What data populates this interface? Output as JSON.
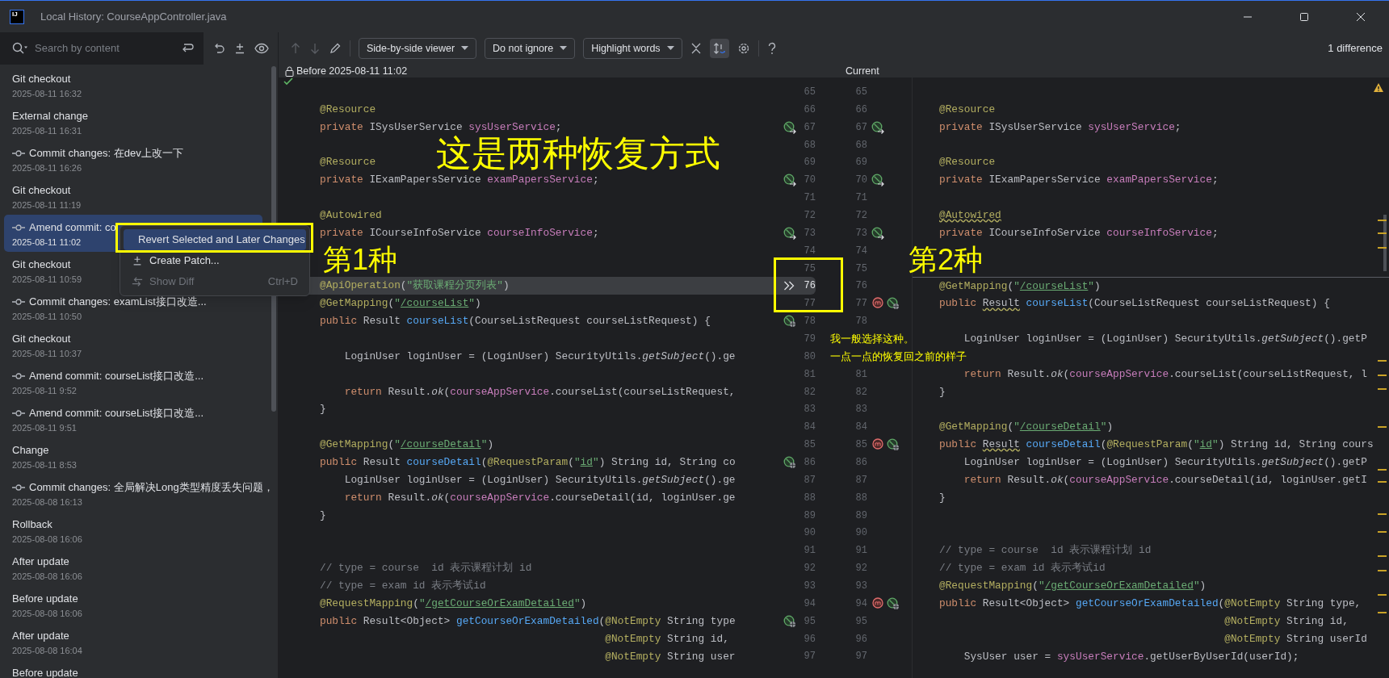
{
  "window": {
    "title": "Local History: CourseAppController.java",
    "app_icon": "IJ"
  },
  "history": {
    "search": {
      "placeholder": "Search by content"
    },
    "items": [
      {
        "kind": "event",
        "title": "Git checkout",
        "time": "2025-08-11 16:32",
        "selected": false
      },
      {
        "kind": "event",
        "title": "External change",
        "time": "2025-08-11 16:31",
        "selected": false
      },
      {
        "kind": "commit",
        "title": "Commit changes: 在dev上改一下",
        "time": "2025-08-11 16:26",
        "selected": false
      },
      {
        "kind": "event",
        "title": "Git checkout",
        "time": "2025-08-11 11:19",
        "selected": false
      },
      {
        "kind": "commit",
        "title": "Amend commit: co",
        "time": "2025-08-11 11:02",
        "selected": true
      },
      {
        "kind": "event",
        "title": "Git checkout",
        "time": "2025-08-11 10:59",
        "selected": false
      },
      {
        "kind": "commit",
        "title": "Commit changes: examList接口改造...",
        "time": "2025-08-11 10:50",
        "selected": false
      },
      {
        "kind": "event",
        "title": "Git checkout",
        "time": "2025-08-11 10:37",
        "selected": false
      },
      {
        "kind": "commit",
        "title": "Amend commit: courseList接口改造...",
        "time": "2025-08-11 9:52",
        "selected": false
      },
      {
        "kind": "commit",
        "title": "Amend commit: courseList接口改造...",
        "time": "2025-08-11 9:51",
        "selected": false
      },
      {
        "kind": "event",
        "title": "Change",
        "time": "2025-08-11 8:53",
        "selected": false
      },
      {
        "kind": "commit",
        "title": "Commit changes: 全局解决Long类型精度丢失问题，",
        "time": "2025-08-08 16:13",
        "selected": false
      },
      {
        "kind": "event",
        "title": "Rollback",
        "time": "2025-08-08 16:06",
        "selected": false
      },
      {
        "kind": "event",
        "title": "After update",
        "time": "2025-08-08 16:06",
        "selected": false
      },
      {
        "kind": "event",
        "title": "Before update",
        "time": "2025-08-08 16:06",
        "selected": false
      },
      {
        "kind": "event",
        "title": "After update",
        "time": "2025-08-08 16:04",
        "selected": false
      },
      {
        "kind": "event",
        "title": "Before update",
        "selected": false
      }
    ]
  },
  "context_menu": {
    "items": [
      {
        "kind": "revert",
        "label": "Revert Selected and Later Changes",
        "selected": true,
        "disabled": false
      },
      {
        "kind": "patch",
        "label": "Create Patch...",
        "selected": false,
        "disabled": false
      },
      {
        "kind": "diff",
        "label": "Show Diff",
        "shortcut": "Ctrl+D",
        "selected": false,
        "disabled": true
      }
    ]
  },
  "toolbar": {
    "dropdowns": [
      {
        "label": "Side-by-side viewer"
      },
      {
        "label": "Do not ignore"
      },
      {
        "label": "Highlight words"
      }
    ],
    "sync_scroll": true,
    "difference_count": "1 difference"
  },
  "headers": {
    "left": "Before 2025-08-11 11:02",
    "right": "Current"
  },
  "diff": {
    "rows": [
      {
        "left_no": "65",
        "right_no": "65"
      },
      {
        "left_no": "66",
        "right_no": "66",
        "left": [
          {
            "kind": "ann",
            "text": "@Resource"
          }
        ],
        "right": [
          {
            "kind": "ann",
            "text": "@Resource"
          }
        ]
      },
      {
        "left_no": "67",
        "right_no": "67",
        "left_marker": {
          "kind": "implementation"
        },
        "right_markers": [
          {
            "kind": "implementation"
          }
        ],
        "left": [
          {
            "kind": "kw",
            "text": "private "
          },
          {
            "kind": "p",
            "text": "ISysUserService "
          },
          {
            "kind": "fld",
            "text": "sysUserService"
          },
          {
            "kind": "p",
            "text": ";"
          }
        ],
        "right": [
          {
            "kind": "kw",
            "text": "private "
          },
          {
            "kind": "p",
            "text": "ISysUserService "
          },
          {
            "kind": "fld",
            "text": "sysUserService"
          },
          {
            "kind": "p",
            "text": ";"
          }
        ]
      },
      {
        "left_no": "68",
        "right_no": "68"
      },
      {
        "left_no": "69",
        "right_no": "69",
        "left": [
          {
            "kind": "ann",
            "text": "@Resource"
          }
        ],
        "right": [
          {
            "kind": "ann",
            "text": "@Resource"
          }
        ]
      },
      {
        "left_no": "70",
        "right_no": "70",
        "left_marker": {
          "kind": "implementation"
        },
        "right_markers": [
          {
            "kind": "implementation"
          }
        ],
        "left": [
          {
            "kind": "kw",
            "text": "private "
          },
          {
            "kind": "p",
            "text": "IExamPapersService "
          },
          {
            "kind": "fld",
            "text": "examPapersService"
          },
          {
            "kind": "p",
            "text": ";"
          }
        ],
        "right": [
          {
            "kind": "kw",
            "text": "private "
          },
          {
            "kind": "p",
            "text": "IExamPapersService "
          },
          {
            "kind": "fld",
            "text": "examPapersService"
          },
          {
            "kind": "p",
            "text": ";"
          }
        ]
      },
      {
        "left_no": "71",
        "right_no": "71"
      },
      {
        "left_no": "72",
        "right_no": "72",
        "left": [
          {
            "kind": "ann",
            "text": "@Autowired"
          }
        ],
        "right": [
          {
            "kind": "annwarn",
            "text": "@Autowired"
          }
        ]
      },
      {
        "left_no": "73",
        "right_no": "73",
        "left_marker": {
          "kind": "implementation"
        },
        "right_markers": [
          {
            "kind": "implementation"
          }
        ],
        "left": [
          {
            "kind": "kw",
            "text": "private "
          },
          {
            "kind": "p",
            "text": "ICourseInfoService "
          },
          {
            "kind": "fld",
            "text": "courseInfoService"
          },
          {
            "kind": "p",
            "text": ";"
          }
        ],
        "right": [
          {
            "kind": "kw",
            "text": "private "
          },
          {
            "kind": "p",
            "text": "ICourseInfoService "
          },
          {
            "kind": "fld",
            "text": "courseInfoService"
          },
          {
            "kind": "p",
            "text": ";"
          }
        ]
      },
      {
        "left_no": "74",
        "right_no": "74"
      },
      {
        "left_no": "75",
        "right_no": "75"
      },
      {
        "left_no": "76",
        "right_no": "76",
        "changed": true,
        "left_marker": {
          "kind": "apply"
        },
        "left": [
          {
            "kind": "ann",
            "text": "@ApiOperation"
          },
          {
            "kind": "p",
            "text": "("
          },
          {
            "kind": "str",
            "text": "\"获取课程分页列表\""
          },
          {
            "kind": "p",
            "text": ")"
          }
        ],
        "right": [
          {
            "kind": "ann",
            "text": "@GetMapping"
          },
          {
            "kind": "p",
            "text": "("
          },
          {
            "kind": "str",
            "text": "\""
          },
          {
            "kind": "url",
            "text": "/courseList"
          },
          {
            "kind": "str",
            "text": "\""
          },
          {
            "kind": "p",
            "text": ")"
          }
        ]
      },
      {
        "left_no": "77",
        "right_no": "77",
        "right_markers": [
          {
            "kind": "mapping"
          },
          {
            "kind": "endpoint"
          }
        ],
        "left": [
          {
            "kind": "ann",
            "text": "@GetMapping"
          },
          {
            "kind": "p",
            "text": "("
          },
          {
            "kind": "str",
            "text": "\""
          },
          {
            "kind": "url",
            "text": "/courseList"
          },
          {
            "kind": "str",
            "text": "\""
          },
          {
            "kind": "p",
            "text": ")"
          }
        ],
        "right": [
          {
            "kind": "kw",
            "text": "public "
          },
          {
            "kind": "warn",
            "text": "Result"
          },
          {
            "kind": "fn",
            "text": " courseList"
          },
          {
            "kind": "p",
            "text": "(CourseListRequest courseListRequest) {"
          }
        ]
      },
      {
        "left_no": "78",
        "right_no": "78",
        "left_marker": {
          "kind": "endpoint"
        },
        "left": [
          {
            "kind": "kw",
            "text": "public "
          },
          {
            "kind": "p",
            "text": "Result "
          },
          {
            "kind": "fn",
            "text": "courseList"
          },
          {
            "kind": "p",
            "text": "(CourseListRequest courseListRequest) {"
          }
        ]
      },
      {
        "left_no": "79",
        "right": [
          {
            "kind": "p",
            "text": "    LoginUser loginUser = (LoginUser) SecurityUtils."
          },
          {
            "kind": "it",
            "text": "getSubject"
          },
          {
            "kind": "p",
            "text": "().getP"
          }
        ]
      },
      {
        "left_no": "80",
        "left": [
          {
            "kind": "p",
            "text": "    LoginUser loginUser = (LoginUser) SecurityUtils."
          },
          {
            "kind": "it",
            "text": "getSubject"
          },
          {
            "kind": "p",
            "text": "().ge"
          }
        ]
      },
      {
        "left_no": "81",
        "right_no": "81",
        "right": [
          {
            "kind": "kw",
            "text": "    return "
          },
          {
            "kind": "p",
            "text": "Result."
          },
          {
            "kind": "it",
            "text": "ok"
          },
          {
            "kind": "p",
            "text": "("
          },
          {
            "kind": "fld",
            "text": "courseAppService"
          },
          {
            "kind": "p",
            "text": ".courseList(courseListRequest, l"
          }
        ]
      },
      {
        "left_no": "82",
        "right_no": "82",
        "left": [
          {
            "kind": "kw",
            "text": "    return "
          },
          {
            "kind": "p",
            "text": "Result."
          },
          {
            "kind": "it",
            "text": "ok"
          },
          {
            "kind": "p",
            "text": "("
          },
          {
            "kind": "fld",
            "text": "courseAppService"
          },
          {
            "kind": "p",
            "text": ".courseList(courseListRequest,"
          }
        ],
        "right": [
          {
            "kind": "p",
            "text": "}"
          }
        ]
      },
      {
        "left_no": "83",
        "right_no": "83",
        "left": [
          {
            "kind": "p",
            "text": "}"
          }
        ]
      },
      {
        "left_no": "84",
        "right_no": "84",
        "right": [
          {
            "kind": "ann",
            "text": "@GetMapping"
          },
          {
            "kind": "p",
            "text": "("
          },
          {
            "kind": "str",
            "text": "\""
          },
          {
            "kind": "url",
            "text": "/courseDetail"
          },
          {
            "kind": "str",
            "text": "\""
          },
          {
            "kind": "p",
            "text": ")"
          }
        ]
      },
      {
        "left_no": "85",
        "right_no": "85",
        "right_markers": [
          {
            "kind": "mapping"
          },
          {
            "kind": "endpoint"
          }
        ],
        "left": [
          {
            "kind": "ann",
            "text": "@GetMapping"
          },
          {
            "kind": "p",
            "text": "("
          },
          {
            "kind": "str",
            "text": "\""
          },
          {
            "kind": "url",
            "text": "/courseDetail"
          },
          {
            "kind": "str",
            "text": "\""
          },
          {
            "kind": "p",
            "text": ")"
          }
        ],
        "right": [
          {
            "kind": "kw",
            "text": "public "
          },
          {
            "kind": "warn",
            "text": "Result"
          },
          {
            "kind": "fn",
            "text": " courseDetail"
          },
          {
            "kind": "p",
            "text": "("
          },
          {
            "kind": "ann",
            "text": "@RequestParam"
          },
          {
            "kind": "p",
            "text": "("
          },
          {
            "kind": "str",
            "text": "\""
          },
          {
            "kind": "url",
            "text": "id"
          },
          {
            "kind": "str",
            "text": "\""
          },
          {
            "kind": "p",
            "text": ") String id, String cours"
          }
        ]
      },
      {
        "left_no": "86",
        "right_no": "86",
        "left_marker": {
          "kind": "endpoint"
        },
        "left": [
          {
            "kind": "kw",
            "text": "public "
          },
          {
            "kind": "p",
            "text": "Result "
          },
          {
            "kind": "fn",
            "text": "courseDetail"
          },
          {
            "kind": "p",
            "text": "("
          },
          {
            "kind": "ann",
            "text": "@RequestParam"
          },
          {
            "kind": "p",
            "text": "("
          },
          {
            "kind": "str",
            "text": "\""
          },
          {
            "kind": "url",
            "text": "id"
          },
          {
            "kind": "str",
            "text": "\""
          },
          {
            "kind": "p",
            "text": ") String id, String co"
          }
        ],
        "right": [
          {
            "kind": "p",
            "text": "    LoginUser loginUser = (LoginUser) SecurityUtils."
          },
          {
            "kind": "it",
            "text": "getSubject"
          },
          {
            "kind": "p",
            "text": "().getP"
          }
        ]
      },
      {
        "left_no": "87",
        "right_no": "87",
        "left": [
          {
            "kind": "p",
            "text": "    LoginUser loginUser = (LoginUser) SecurityUtils."
          },
          {
            "kind": "it",
            "text": "getSubject"
          },
          {
            "kind": "p",
            "text": "().ge"
          }
        ],
        "right": [
          {
            "kind": "kw",
            "text": "    return "
          },
          {
            "kind": "p",
            "text": "Result."
          },
          {
            "kind": "it",
            "text": "ok"
          },
          {
            "kind": "p",
            "text": "("
          },
          {
            "kind": "fld",
            "text": "courseAppService"
          },
          {
            "kind": "p",
            "text": ".courseDetail(id, loginUser.getI"
          }
        ]
      },
      {
        "left_no": "88",
        "right_no": "88",
        "left": [
          {
            "kind": "kw",
            "text": "    return "
          },
          {
            "kind": "p",
            "text": "Result."
          },
          {
            "kind": "it",
            "text": "ok"
          },
          {
            "kind": "p",
            "text": "("
          },
          {
            "kind": "fld",
            "text": "courseAppService"
          },
          {
            "kind": "p",
            "text": ".courseDetail(id, loginUser.ge"
          }
        ],
        "right": [
          {
            "kind": "p",
            "text": "}"
          }
        ]
      },
      {
        "left_no": "89",
        "right_no": "89",
        "left": [
          {
            "kind": "p",
            "text": "}"
          }
        ]
      },
      {
        "left_no": "90",
        "right_no": "90"
      },
      {
        "left_no": "91",
        "right_no": "91",
        "right": [
          {
            "kind": "cmt",
            "text": "// type = course  id 表示课程计划 id"
          }
        ]
      },
      {
        "left_no": "92",
        "right_no": "92",
        "left": [
          {
            "kind": "cmt",
            "text": "// type = course  id 表示课程计划 id"
          }
        ],
        "right": [
          {
            "kind": "cmt",
            "text": "// type = exam id 表示考试id"
          }
        ]
      },
      {
        "left_no": "93",
        "right_no": "93",
        "left": [
          {
            "kind": "cmt",
            "text": "// type = exam id 表示考试id"
          }
        ],
        "right": [
          {
            "kind": "ann",
            "text": "@RequestMapping"
          },
          {
            "kind": "p",
            "text": "("
          },
          {
            "kind": "str",
            "text": "\""
          },
          {
            "kind": "url",
            "text": "/getCourseOrExamDetailed"
          },
          {
            "kind": "str",
            "text": "\""
          },
          {
            "kind": "p",
            "text": ")"
          }
        ]
      },
      {
        "left_no": "94",
        "right_no": "94",
        "right_markers": [
          {
            "kind": "mapping"
          },
          {
            "kind": "endpoint"
          }
        ],
        "left": [
          {
            "kind": "ann",
            "text": "@RequestMapping"
          },
          {
            "kind": "p",
            "text": "("
          },
          {
            "kind": "str",
            "text": "\""
          },
          {
            "kind": "url",
            "text": "/getCourseOrExamDetailed"
          },
          {
            "kind": "str",
            "text": "\""
          },
          {
            "kind": "p",
            "text": ")"
          }
        ],
        "right": [
          {
            "kind": "kw",
            "text": "public "
          },
          {
            "kind": "p",
            "text": "Result<Object> "
          },
          {
            "kind": "fn",
            "text": "getCourseOrExamDetailed"
          },
          {
            "kind": "p",
            "text": "("
          },
          {
            "kind": "ann",
            "text": "@NotEmpty"
          },
          {
            "kind": "p",
            "text": " String type,"
          }
        ]
      },
      {
        "left_no": "95",
        "right_no": "95",
        "left_marker": {
          "kind": "endpoint"
        },
        "left": [
          {
            "kind": "kw",
            "text": "public "
          },
          {
            "kind": "p",
            "text": "Result<Object> "
          },
          {
            "kind": "fn",
            "text": "getCourseOrExamDetailed"
          },
          {
            "kind": "p",
            "text": "("
          },
          {
            "kind": "ann",
            "text": "@NotEmpty"
          },
          {
            "kind": "p",
            "text": " String type"
          }
        ],
        "right": [
          {
            "kind": "ann",
            "text": "                                              @NotEmpty"
          },
          {
            "kind": "p",
            "text": " String id,"
          }
        ]
      },
      {
        "left_no": "96",
        "right_no": "96",
        "left": [
          {
            "kind": "ann",
            "text": "                                              @NotEmpty"
          },
          {
            "kind": "p",
            "text": " String id,"
          }
        ],
        "right": [
          {
            "kind": "ann",
            "text": "                                              @NotEmpty"
          },
          {
            "kind": "p",
            "text": " String userId"
          }
        ]
      },
      {
        "left_no": "97",
        "right_no": "97",
        "left": [
          {
            "kind": "ann",
            "text": "                                              @NotEmpty"
          },
          {
            "kind": "p",
            "text": " String user"
          }
        ],
        "right": [
          {
            "kind": "p",
            "text": "    SysUser user = "
          },
          {
            "kind": "fld",
            "text": "sysUserService"
          },
          {
            "kind": "p",
            "text": ".getUserByUserId(userId);"
          }
        ]
      }
    ]
  },
  "annotations": {
    "headline": "这是两种恢复方式",
    "first": "第1种",
    "second": "第2种",
    "note": [
      "我一般选择这种。",
      "一点一点的恢复回之前的样子"
    ]
  }
}
